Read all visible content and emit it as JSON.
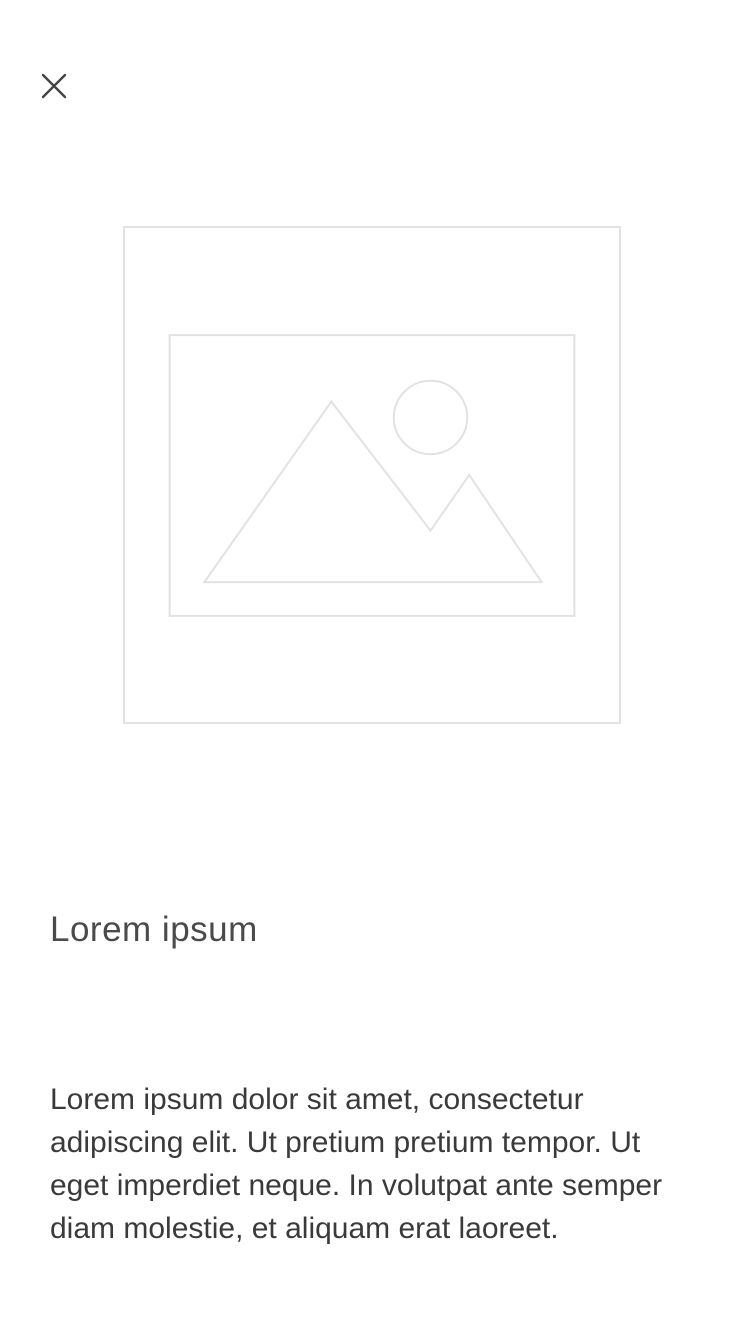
{
  "header": {
    "close_icon": "close-icon"
  },
  "media": {
    "placeholder_icon": "image-placeholder-icon"
  },
  "content": {
    "title": "Lorem ipsum",
    "body": "Lorem ipsum dolor sit amet, consectetur adipiscing elit. Ut pretium pretium tempor. Ut eget imperdiet neque. In volutpat ante semper diam molestie, et aliquam erat laoreet."
  },
  "colors": {
    "background": "#ffffff",
    "icon": "#444444",
    "placeholder_stroke": "#e2e2e2",
    "title_text": "#4a4a4a",
    "body_text": "#3a3a3a"
  }
}
